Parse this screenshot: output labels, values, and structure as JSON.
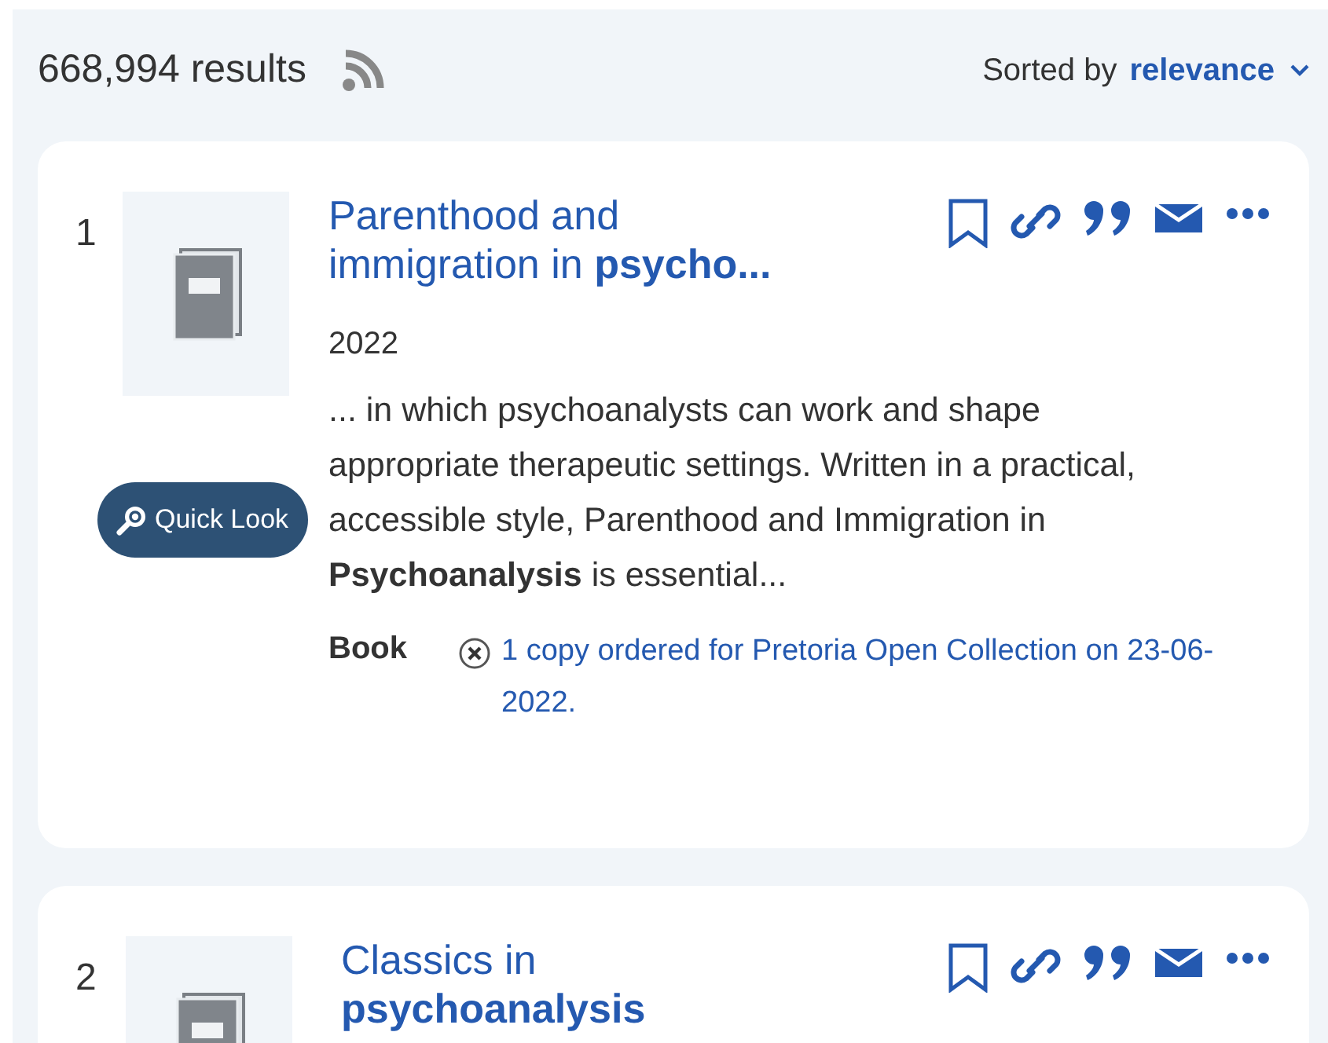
{
  "header": {
    "count": "668,994 results",
    "sort_label": "Sorted by",
    "sort_value": "relevance"
  },
  "results": [
    {
      "number": "1",
      "title": "Parenthood and immigration in **psycho...**",
      "quick_look": "Quick Look",
      "year": "2022",
      "snippet": "... in which psychoanalysts can work and shape appropriate therapeutic settings. Written in a practical, accessible style, Parenthood and Immigration in **Psychoanalysis** is essential...",
      "type": "Book",
      "availability": "1 copy ordered for Pretoria Open Collection on 23-06-2022."
    },
    {
      "number": "2",
      "title": "Classics in **psychoanalysis**"
    }
  ]
}
